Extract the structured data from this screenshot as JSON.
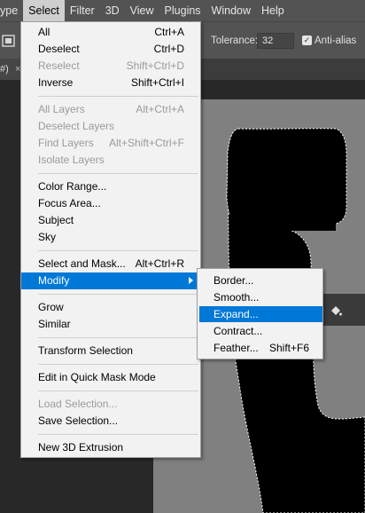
{
  "menubar": {
    "items": [
      "ype",
      "Select",
      "Filter",
      "3D",
      "View",
      "Plugins",
      "Window",
      "Help"
    ],
    "active": "Select"
  },
  "options": {
    "tolerance_label": "Tolerance:",
    "tolerance_value": "32",
    "antialias_label": "Anti-alias",
    "antialias_checked": true
  },
  "doc_tab": {
    "title": "#)",
    "close": "×"
  },
  "select_menu": {
    "items": [
      {
        "label": "All",
        "shortcut": "Ctrl+A",
        "disabled": false
      },
      {
        "label": "Deselect",
        "shortcut": "Ctrl+D",
        "disabled": false
      },
      {
        "label": "Reselect",
        "shortcut": "Shift+Ctrl+D",
        "disabled": true
      },
      {
        "label": "Inverse",
        "shortcut": "Shift+Ctrl+I",
        "disabled": false
      },
      {
        "label": "All Layers",
        "shortcut": "Alt+Ctrl+A",
        "disabled": true
      },
      {
        "label": "Deselect Layers",
        "shortcut": "",
        "disabled": true
      },
      {
        "label": "Find Layers",
        "shortcut": "Alt+Shift+Ctrl+F",
        "disabled": true
      },
      {
        "label": "Isolate Layers",
        "shortcut": "",
        "disabled": true
      },
      {
        "label": "Color Range...",
        "shortcut": "",
        "disabled": false
      },
      {
        "label": "Focus Area...",
        "shortcut": "",
        "disabled": false
      },
      {
        "label": "Subject",
        "shortcut": "",
        "disabled": false
      },
      {
        "label": "Sky",
        "shortcut": "",
        "disabled": false
      },
      {
        "label": "Select and Mask...",
        "shortcut": "Alt+Ctrl+R",
        "disabled": false
      },
      {
        "label": "Modify",
        "shortcut": "",
        "disabled": false,
        "highlighted": true,
        "submenu": true
      },
      {
        "label": "Grow",
        "shortcut": "",
        "disabled": false
      },
      {
        "label": "Similar",
        "shortcut": "",
        "disabled": false
      },
      {
        "label": "Transform Selection",
        "shortcut": "",
        "disabled": false
      },
      {
        "label": "Edit in Quick Mask Mode",
        "shortcut": "",
        "disabled": false
      },
      {
        "label": "Load Selection...",
        "shortcut": "",
        "disabled": true
      },
      {
        "label": "Save Selection...",
        "shortcut": "",
        "disabled": false
      },
      {
        "label": "New 3D Extrusion",
        "shortcut": "",
        "disabled": false
      }
    ]
  },
  "modify_submenu": {
    "items": [
      {
        "label": "Border...",
        "shortcut": ""
      },
      {
        "label": "Smooth...",
        "shortcut": ""
      },
      {
        "label": "Expand...",
        "shortcut": "",
        "highlighted": true
      },
      {
        "label": "Contract...",
        "shortcut": ""
      },
      {
        "label": "Feather...",
        "shortcut": "Shift+F6"
      }
    ]
  },
  "colors": {
    "highlight": "#0078d7",
    "menu_bg": "#f2f2f2",
    "chrome": "#535353",
    "canvas_gray": "#808080",
    "shape_black": "#000000"
  }
}
